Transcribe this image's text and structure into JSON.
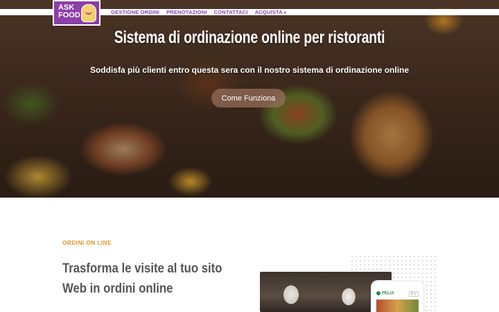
{
  "logo": {
    "text_line1": "ASK",
    "text_line2": "FOOD"
  },
  "nav": {
    "items": [
      {
        "label": "GESTIONE ORDINI"
      },
      {
        "label": "PRENOTAZIONI"
      },
      {
        "label": "CONTATTACI"
      },
      {
        "label": "ACQUISTA",
        "has_dropdown": true
      }
    ],
    "chevron": "▾"
  },
  "hero": {
    "title": "Sistema di ordinazione online per ristoranti",
    "subtitle": "Soddisfa più clienti entro questa sera con il nostro sistema di ordinazione online",
    "button_label": "Come Funziona"
  },
  "section": {
    "kicker": "ORDINI ON LINE",
    "heading": "Trasforma le visite al tuo sito Web in ordini online"
  },
  "phone_mockup": {
    "brand": "PELIA",
    "control": "D V"
  },
  "colors": {
    "brand_purple": "#8b3fa8",
    "accent_orange": "#e8932a",
    "heading_gray": "#555555"
  }
}
